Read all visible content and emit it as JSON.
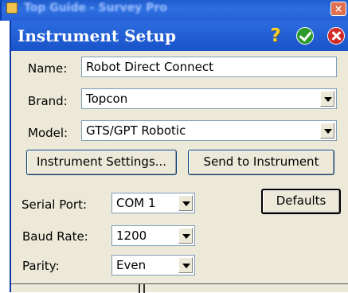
{
  "window": {
    "title_text": "Top Guide - Survey Pro"
  },
  "dialog": {
    "title": "Instrument Setup",
    "help_glyph": "?",
    "ok_icon": "check-icon",
    "cancel_icon": "close-icon"
  },
  "form": {
    "name": {
      "label": "Name:",
      "value": "Robot Direct Connect"
    },
    "brand": {
      "label": "Brand:",
      "value": "Topcon"
    },
    "model": {
      "label": "Model:",
      "value": "GTS/GPT Robotic"
    },
    "instrument_settings_button": "Instrument Settings...",
    "send_to_instrument_button": "Send to Instrument",
    "serial_port": {
      "label": "Serial Port:",
      "value": "COM 1"
    },
    "baud_rate": {
      "label": "Baud Rate:",
      "value": "1200"
    },
    "parity": {
      "label": "Parity:",
      "value": "Even"
    },
    "defaults_button": "Defaults"
  },
  "colors": {
    "title_bar_blue": "#1a53c9",
    "dialog_face": "#ece9d8",
    "ok_green": "#2b9b2b",
    "cancel_red": "#d42a2a",
    "help_yellow": "#f6d22a"
  }
}
